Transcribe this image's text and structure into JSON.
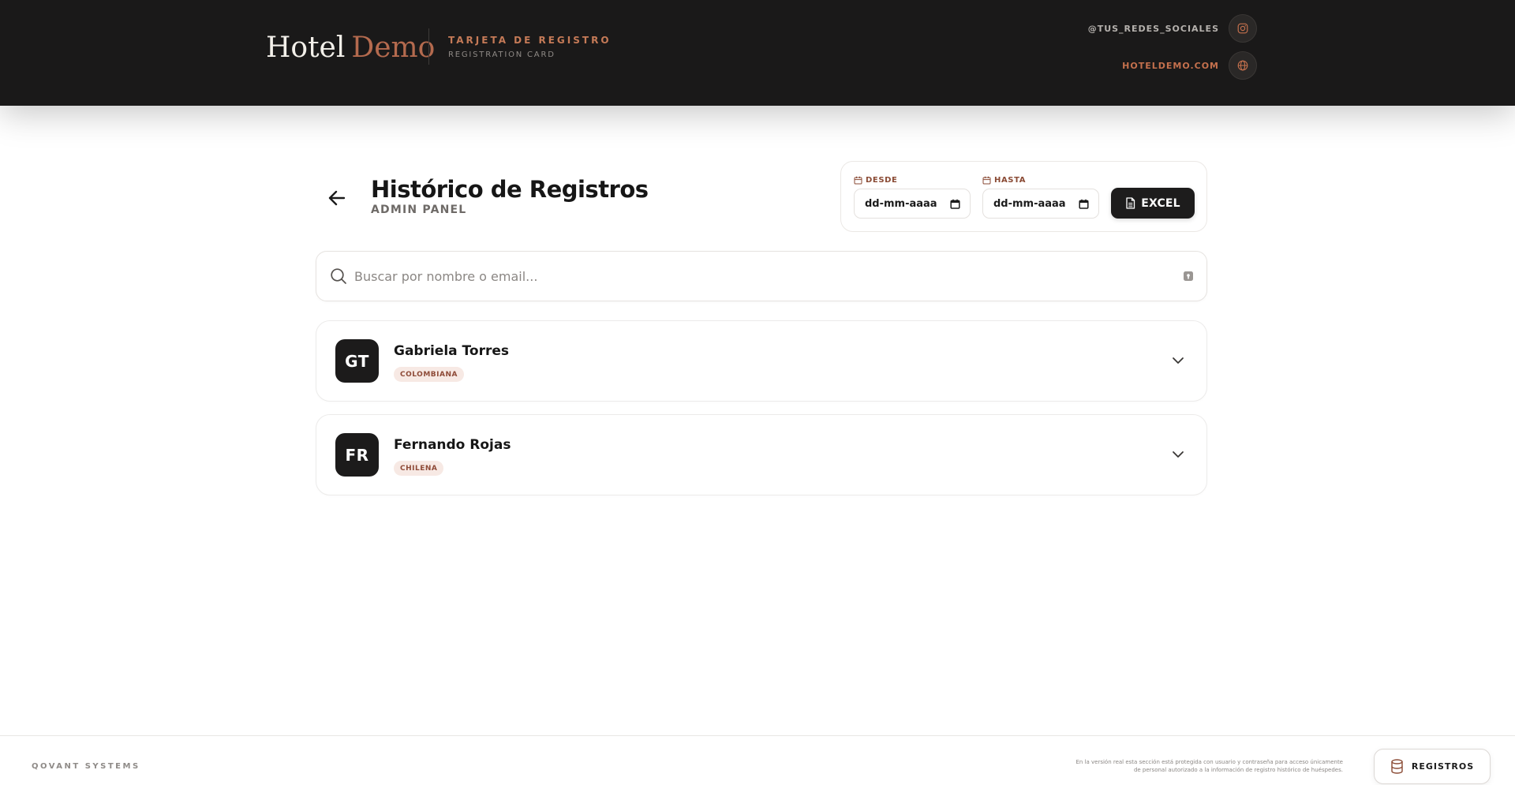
{
  "header": {
    "brand_first": "Hotel",
    "brand_second": "Demo",
    "card_title": "TARJETA DE REGISTRO",
    "card_subtitle": "REGISTRATION CARD",
    "social_handle": "@TUS_REDES_SOCIALES",
    "website": "HOTELDEMO.COM",
    "social_icon": "instagram-icon",
    "website_icon": "globe-icon"
  },
  "main": {
    "back_icon": "arrow-left-icon",
    "title": "Histórico de Registros",
    "subtitle": "ADMIN PANEL"
  },
  "filters": {
    "from_label": "DESDE",
    "from_value": "dd-mm-aaaa",
    "to_label": "HASTA",
    "to_value": "dd-mm-aaaa",
    "excel_label": "EXCEL"
  },
  "search": {
    "placeholder": "Buscar por nombre o email..."
  },
  "guests": [
    {
      "initials": "GT",
      "name": "Gabriela Torres",
      "nationality": "COLOMBIANA"
    },
    {
      "initials": "FR",
      "name": "Fernando Rojas",
      "nationality": "CHILENA"
    }
  ],
  "footer": {
    "brand": "QOVANT SYSTEMS",
    "note_line1": "En la versión real esta sección está protegida con usuario y contraseña para acceso únicamente",
    "note_line2": "de personal autorizado a la información de registro histórico de huéspedes.",
    "registros_label": "REGISTROS"
  },
  "colors": {
    "header_bg": "#1a1919",
    "accent": "#c4704d",
    "badge_bg": "#f7e9e4",
    "badge_text": "#8e4a37",
    "dark_button": "#1d1c1c"
  }
}
